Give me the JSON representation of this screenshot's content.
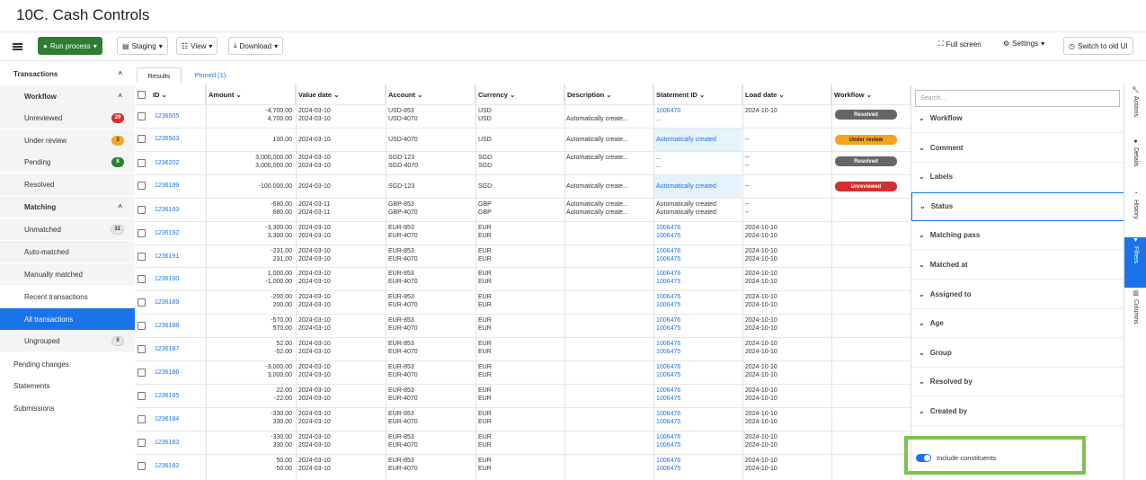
{
  "page_title": "10C. Cash Controls",
  "toolbar": {
    "run_process": "Run process",
    "staging": "Staging",
    "view": "View",
    "download": "Download",
    "full_screen": "Full screen",
    "settings": "Settings",
    "switch_old_ui": "Switch to old UI"
  },
  "sidebar": {
    "transactions": "Transactions",
    "workflow": "Workflow",
    "unreviewed": "Unreviewed",
    "unreviewed_count": "29",
    "under_review": "Under review",
    "under_review_count": "3",
    "pending": "Pending",
    "pending_count": "8",
    "resolved": "Resolved",
    "matching": "Matching",
    "unmatched": "Unmatched",
    "unmatched_count": "31",
    "auto_matched": "Auto-matched",
    "manually_matched": "Manually matched",
    "recent_transactions": "Recent transactions",
    "all_transactions": "All transactions",
    "ungrouped": "Ungrouped",
    "ungrouped_count": "0",
    "pending_changes": "Pending changes",
    "statements": "Statements",
    "submissions": "Submissions"
  },
  "tabs": {
    "results": "Results",
    "pinned": "Pinned (1)"
  },
  "columns": {
    "id": "ID",
    "amount": "Amount",
    "value_date": "Value date",
    "account": "Account",
    "currency": "Currency",
    "description": "Description",
    "statement_id": "Statement ID",
    "load_date": "Load date",
    "workflow": "Workflow"
  },
  "rows": [
    {
      "id": "1236505",
      "amount": "-4,700.00\n4,700.00",
      "value_date": "2024-03-10\n2024-03-10",
      "account": "USD-853\nUSD-4070",
      "currency": "USD\nUSD",
      "description": "\nAutomatically create...",
      "statement_id": "1006470\n...",
      "load_date": "2024-10-10\n",
      "workflow": "Resolved",
      "wf_color": "gray"
    },
    {
      "id": "1236503",
      "amount": "100.00",
      "value_date": "2024-03-10",
      "account": "USD-4070",
      "currency": "USD",
      "description": "Automatically create...",
      "statement_id": "Automatically created",
      "load_date": "--",
      "workflow": "Under review",
      "wf_color": "yellow"
    },
    {
      "id": "1236202",
      "amount": "3,000,000.00\n3,000,000.00",
      "value_date": "2024-03-10\n2024-03-10",
      "account": "SGD-123\nSGD-4070",
      "currency": "SGD\nSGD",
      "description": "Automatically create...\n",
      "statement_id": "...\n...",
      "load_date": "--\n--",
      "workflow": "Resolved",
      "wf_color": "gray"
    },
    {
      "id": "1236199",
      "amount": "-100,000.00",
      "value_date": "2024-03-10",
      "account": "SGD-123",
      "currency": "SGD",
      "description": "Automatically create...",
      "statement_id": "Automatically created",
      "load_date": "--",
      "workflow": "Unreviewed",
      "wf_color": "red"
    },
    {
      "id": "1236193",
      "amount": "-680.00\n680.00",
      "value_date": "2024-03-11\n2024-03-11",
      "account": "GBP-853\nGBP-4070",
      "currency": "GBP\nGBP",
      "description": "Automatically create...\nAutomatically create...",
      "statement_id": "Automatically created\nAutomatically created",
      "load_date": "--\n--",
      "workflow": "",
      "wf_color": ""
    },
    {
      "id": "1236192",
      "amount": "-3,300.00\n3,300.00",
      "value_date": "2024-03-10\n2024-03-10",
      "account": "EUR-853\nEUR-4070",
      "currency": "EUR\nEUR",
      "description": "",
      "statement_id": "1006476\n1006475",
      "load_date": "2024-10-10\n2024-10-10",
      "workflow": "",
      "wf_color": ""
    },
    {
      "id": "1236191",
      "amount": "-231.00\n231.00",
      "value_date": "2024-03-10\n2024-03-10",
      "account": "EUR-853\nEUR-4070",
      "currency": "EUR\nEUR",
      "description": "",
      "statement_id": "1006476\n1006475",
      "load_date": "2024-10-10\n2024-10-10",
      "workflow": "",
      "wf_color": ""
    },
    {
      "id": "1236190",
      "amount": "1,000.00\n-1,000.00",
      "value_date": "2024-03-10\n2024-03-10",
      "account": "EUR-853\nEUR-4070",
      "currency": "EUR\nEUR",
      "description": "",
      "statement_id": "1006476\n1006475",
      "load_date": "2024-10-10\n2024-10-10",
      "workflow": "",
      "wf_color": ""
    },
    {
      "id": "1236189",
      "amount": "-200.00\n200.00",
      "value_date": "2024-03-10\n2024-03-10",
      "account": "EUR-853\nEUR-4070",
      "currency": "EUR\nEUR",
      "description": "",
      "statement_id": "1006476\n1006475",
      "load_date": "2024-10-10\n2024-10-10",
      "workflow": "",
      "wf_color": ""
    },
    {
      "id": "1236188",
      "amount": "-570.00\n570.00",
      "value_date": "2024-03-10\n2024-03-10",
      "account": "EUR-853\nEUR-4070",
      "currency": "EUR\nEUR",
      "description": "",
      "statement_id": "1006476\n1006475",
      "load_date": "2024-10-10\n2024-10-10",
      "workflow": "",
      "wf_color": ""
    },
    {
      "id": "1236187",
      "amount": "52.00\n-52.00",
      "value_date": "2024-03-10\n2024-03-10",
      "account": "EUR-853\nEUR-4070",
      "currency": "EUR\nEUR",
      "description": "",
      "statement_id": "1006476\n1006475",
      "load_date": "2024-10-10\n2024-10-10",
      "workflow": "",
      "wf_color": ""
    },
    {
      "id": "1236186",
      "amount": "-3,000.00\n3,000.00",
      "value_date": "2024-03-10\n2024-03-10",
      "account": "EUR-853\nEUR-4070",
      "currency": "EUR\nEUR",
      "description": "",
      "statement_id": "1006476\n1006475",
      "load_date": "2024-10-10\n2024-10-10",
      "workflow": "",
      "wf_color": ""
    },
    {
      "id": "1236185",
      "amount": "22.00\n-22.00",
      "value_date": "2024-03-10\n2024-03-10",
      "account": "EUR-853\nEUR-4070",
      "currency": "EUR\nEUR",
      "description": "",
      "statement_id": "1006476\n1006475",
      "load_date": "2024-10-10\n2024-10-10",
      "workflow": "",
      "wf_color": ""
    },
    {
      "id": "1236184",
      "amount": "-330.00\n330.00",
      "value_date": "2024-03-10\n2024-03-10",
      "account": "EUR-853\nEUR-4070",
      "currency": "EUR\nEUR",
      "description": "",
      "statement_id": "1006476\n1006475",
      "load_date": "2024-10-10\n2024-10-10",
      "workflow": "",
      "wf_color": ""
    },
    {
      "id": "1236183",
      "amount": "-330.00\n330.00",
      "value_date": "2024-03-10\n2024-03-10",
      "account": "EUR-853\nEUR-4070",
      "currency": "EUR\nEUR",
      "description": "",
      "statement_id": "1006476\n1006475",
      "load_date": "2024-10-10\n2024-10-10",
      "workflow": "",
      "wf_color": ""
    },
    {
      "id": "1236182",
      "amount": "50.00\n-50.00",
      "value_date": "2024-03-10\n2024-03-10",
      "account": "EUR-853\nEUR-4070",
      "currency": "EUR\nEUR",
      "description": "",
      "statement_id": "1006476\n1006475",
      "load_date": "2024-10-10\n2024-10-10",
      "workflow": "",
      "wf_color": ""
    }
  ],
  "filters": {
    "search_placeholder": "Search...",
    "items": [
      "Workflow",
      "Comment",
      "Labels",
      "Status",
      "Matching pass",
      "Matched at",
      "Assigned to",
      "Age",
      "Group",
      "Resolved by",
      "Created by"
    ],
    "include_constituents": "Include constituents"
  },
  "rail": {
    "actions": "Actions",
    "details": "Details",
    "history": "History",
    "filters": "Filters",
    "columns": "Columns"
  },
  "colors": {
    "accent": "#1a73e8",
    "run_green": "#2e7d32",
    "highlight_box": "#7dc34b"
  }
}
